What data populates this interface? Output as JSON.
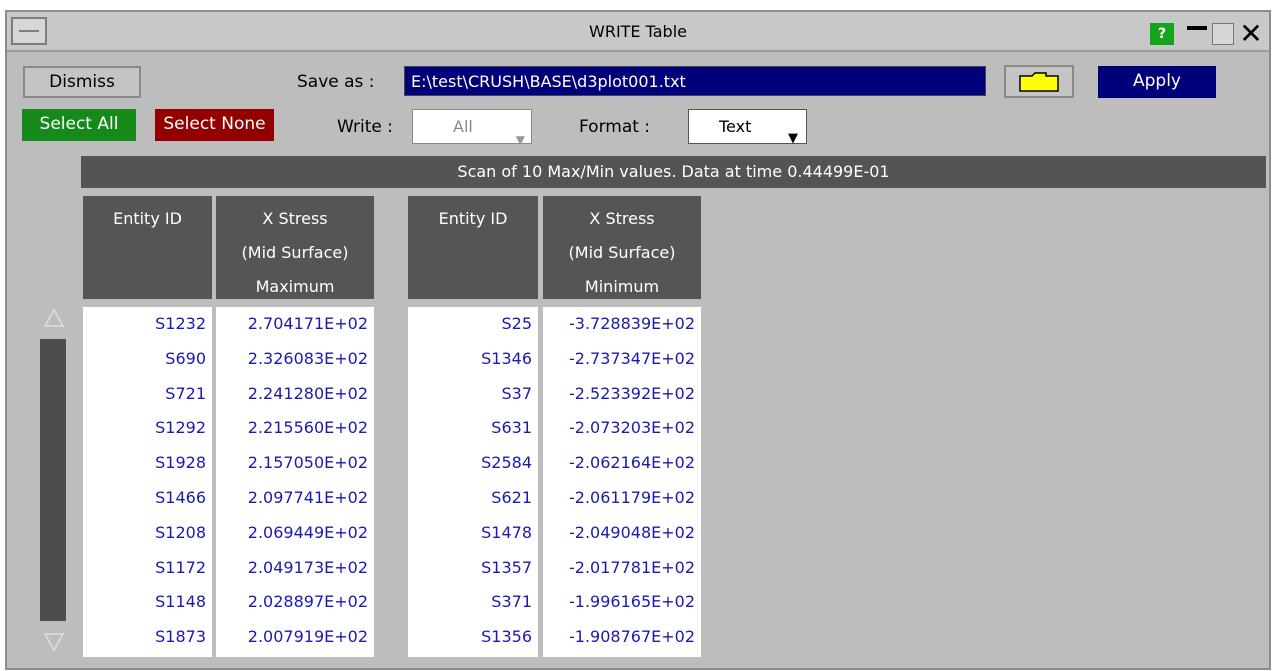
{
  "window": {
    "title": "WRITE Table",
    "help_label": "?",
    "close_label": "✕"
  },
  "toolbar": {
    "dismiss_label": "Dismiss",
    "save_as_label": "Save as :",
    "save_as_value": "E:\\test\\CRUSH\\BASE\\d3plot001.txt",
    "apply_label": "Apply",
    "select_all_label": "Select All",
    "select_none_label": "Select None",
    "write_label": "Write :",
    "write_value": "All",
    "format_label": "Format :",
    "format_value": "Text"
  },
  "scan": {
    "summary": "Scan of 10 Max/Min values.  Data at time  0.44499E-01"
  },
  "tables": {
    "max": {
      "headers": {
        "id": "Entity ID",
        "value_line1": "X Stress",
        "value_line2": "(Mid Surface)",
        "value_line3": "Maximum"
      },
      "rows": [
        {
          "id": "S1232",
          "value": "2.704171E+02"
        },
        {
          "id": "S690",
          "value": "2.326083E+02"
        },
        {
          "id": "S721",
          "value": "2.241280E+02"
        },
        {
          "id": "S1292",
          "value": "2.215560E+02"
        },
        {
          "id": "S1928",
          "value": "2.157050E+02"
        },
        {
          "id": "S1466",
          "value": "2.097741E+02"
        },
        {
          "id": "S1208",
          "value": "2.069449E+02"
        },
        {
          "id": "S1172",
          "value": "2.049173E+02"
        },
        {
          "id": "S1148",
          "value": "2.028897E+02"
        },
        {
          "id": "S1873",
          "value": "2.007919E+02"
        }
      ]
    },
    "min": {
      "headers": {
        "id": "Entity ID",
        "value_line1": "X Stress",
        "value_line2": "(Mid Surface)",
        "value_line3": "Minimum"
      },
      "rows": [
        {
          "id": "S25",
          "value": "-3.728839E+02"
        },
        {
          "id": "S1346",
          "value": "-2.737347E+02"
        },
        {
          "id": "S37",
          "value": "-2.523392E+02"
        },
        {
          "id": "S631",
          "value": "-2.073203E+02"
        },
        {
          "id": "S2584",
          "value": "-2.062164E+02"
        },
        {
          "id": "S621",
          "value": "-2.061179E+02"
        },
        {
          "id": "S1478",
          "value": "-2.049048E+02"
        },
        {
          "id": "S1357",
          "value": "-2.017781E+02"
        },
        {
          "id": "S371",
          "value": "-1.996165E+02"
        },
        {
          "id": "S1356",
          "value": "-1.908767E+02"
        }
      ]
    }
  },
  "colors": {
    "apply_bg": "#00007a",
    "select_all_bg": "#158a1a",
    "select_none_bg": "#930000",
    "value_text": "#1a1ab0"
  },
  "icons": [
    "window-menu-icon",
    "help-icon",
    "minimize-icon",
    "maximize-icon",
    "close-icon",
    "folder-icon",
    "scroll-up-icon",
    "scroll-down-icon"
  ]
}
